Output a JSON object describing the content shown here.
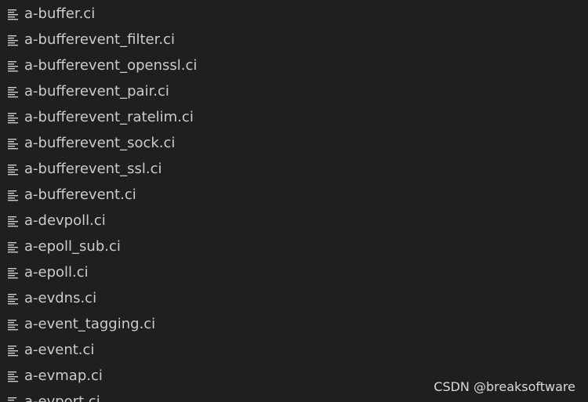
{
  "explorer": {
    "icon": "text-file-icon",
    "files": [
      "a-buffer.ci",
      "a-bufferevent_filter.ci",
      "a-bufferevent_openssl.ci",
      "a-bufferevent_pair.ci",
      "a-bufferevent_ratelim.ci",
      "a-bufferevent_sock.ci",
      "a-bufferevent_ssl.ci",
      "a-bufferevent.ci",
      "a-devpoll.ci",
      "a-epoll_sub.ci",
      "a-epoll.ci",
      "a-evdns.ci",
      "a-event_tagging.ci",
      "a-event.ci",
      "a-evmap.ci",
      "a-evport.ci"
    ]
  },
  "watermark": "CSDN @breaksoftware",
  "colors": {
    "background": "#1f1f1f",
    "text": "#cccccc",
    "icon": "#cccccc"
  }
}
